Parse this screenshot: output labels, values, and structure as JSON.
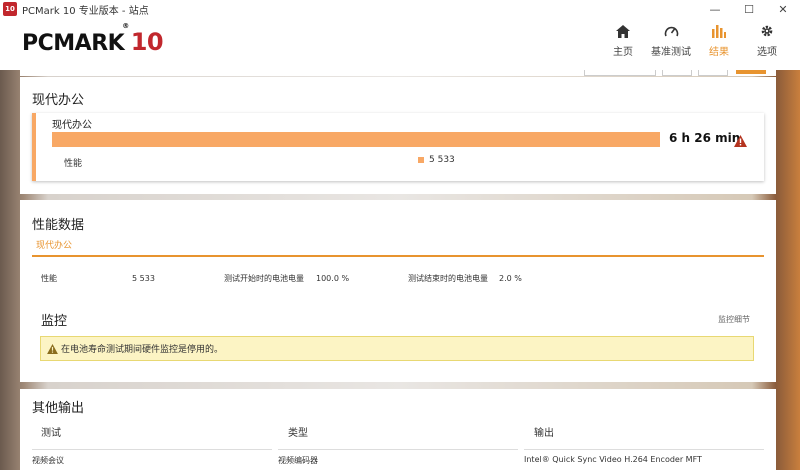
{
  "window": {
    "title": "PCMark 10 专业版本 - 站点",
    "app_badge": "10",
    "minimize": "—",
    "maximize": "☐",
    "close": "✕"
  },
  "logo": {
    "text": "PCMARK",
    "num": "10",
    "mark": "®"
  },
  "nav": [
    {
      "label": "主页",
      "icon": "home-icon"
    },
    {
      "label": "基准测试",
      "icon": "gauge-icon"
    },
    {
      "label": "结果",
      "icon": "bar-chart-icon",
      "active": true
    },
    {
      "label": "选项",
      "icon": "gear-icon"
    }
  ],
  "result": {
    "section_title": "现代办公",
    "name": "现代办公",
    "bar_fraction": 1.0,
    "value": "6 h 26 min",
    "perf_label": "性能",
    "perf_value": "5 533"
  },
  "perf": {
    "title": "性能数据",
    "tab": "现代办公",
    "items": [
      {
        "label": "性能",
        "value": "5 533"
      },
      {
        "label": "测试开始时的电池电量",
        "value": "100.0 %"
      },
      {
        "label": "测试结束时的电池电量",
        "value": "2.0 %"
      }
    ],
    "monitor_title": "监控",
    "monitor_link": "监控细节",
    "warning": "在电池寿命测试期间硬件监控是停用的。"
  },
  "other": {
    "title": "其他输出",
    "headers": [
      "测试",
      "类型",
      "输出"
    ],
    "row": [
      "视频会议",
      "视频编码器",
      "Intel® Quick Sync Video H.264 Encoder MFT"
    ]
  },
  "colors": {
    "accent": "#e8942f",
    "bar": "#f8a865",
    "warning_bg": "#fcf4c4",
    "warning_icon": "#b5341f"
  }
}
